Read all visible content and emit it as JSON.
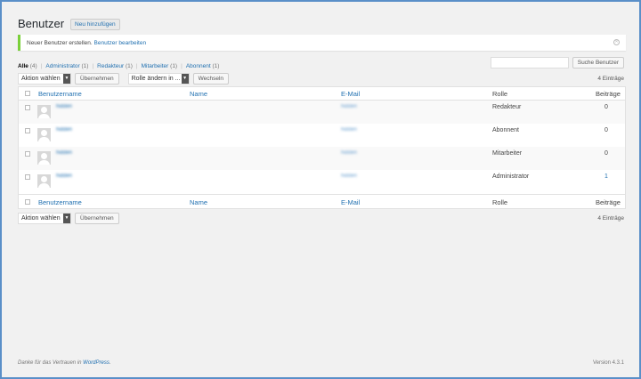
{
  "header": {
    "title": "Benutzer",
    "add_new": "Neu hinzufügen"
  },
  "notice": {
    "text": "Neuer Benutzer erstellen.",
    "link": "Benutzer bearbeiten"
  },
  "filters": [
    {
      "label": "Alle",
      "count": "(4)"
    },
    {
      "label": "Administrator",
      "count": "(1)"
    },
    {
      "label": "Redakteur",
      "count": "(1)"
    },
    {
      "label": "Mitarbeiter",
      "count": "(1)"
    },
    {
      "label": "Abonnent",
      "count": "(1)"
    }
  ],
  "search": {
    "button": "Suche Benutzer"
  },
  "bulk": {
    "action": "Aktion wählen",
    "apply": "Übernehmen",
    "role_change": "Rolle ändern in ...",
    "switch": "Wechseln"
  },
  "count_text": "4 Einträge",
  "columns": {
    "username": "Benutzername",
    "name": "Name",
    "email": "E-Mail",
    "role": "Rolle",
    "posts": "Beiträge"
  },
  "rows": [
    {
      "username": "hidden",
      "email": "hidden",
      "role": "Redakteur",
      "posts": "0"
    },
    {
      "username": "hidden",
      "email": "hidden",
      "role": "Abonnent",
      "posts": "0"
    },
    {
      "username": "hidden",
      "email": "hidden",
      "role": "Mitarbeiter",
      "posts": "0"
    },
    {
      "username": "hidden",
      "email": "hidden",
      "role": "Administrator",
      "posts": "1"
    }
  ],
  "footer": {
    "text_pre": "Danke für das Vertrauen in ",
    "link": "WordPress",
    "text_post": ".",
    "version": "Version 4.3.1"
  },
  "colors": {
    "accent": "#2271b1",
    "notice_border": "#7ad03a",
    "frame": "#5a8fc8"
  }
}
